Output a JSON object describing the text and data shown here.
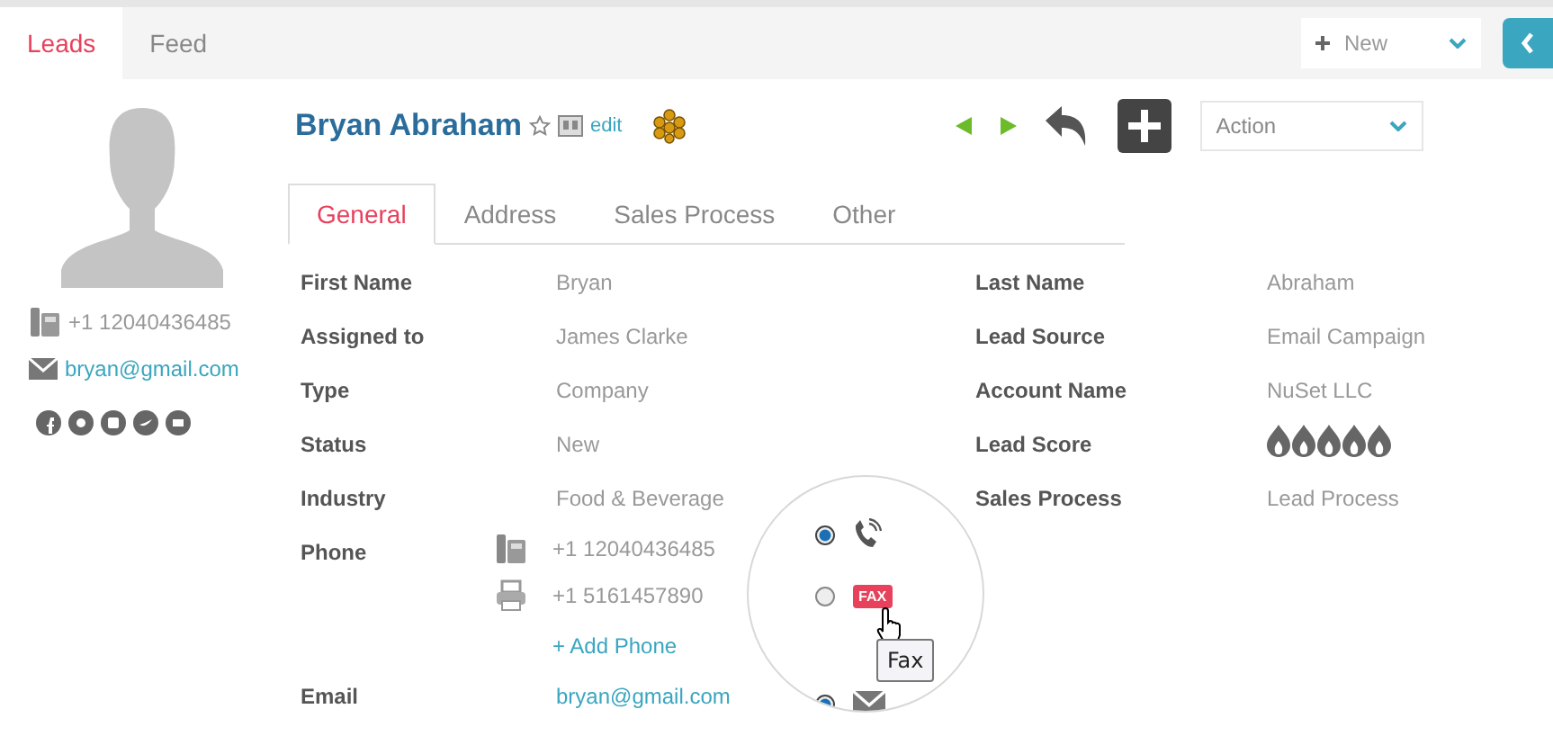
{
  "top_tabs": [
    {
      "label": "Leads",
      "selected": true
    },
    {
      "label": "Feed",
      "selected": false
    }
  ],
  "new_menu": {
    "label": "New"
  },
  "sidebar": {
    "phone": "+1 12040436485",
    "email": "bryan@gmail.com"
  },
  "record": {
    "name": "Bryan Abraham",
    "edit": "edit",
    "action": "Action"
  },
  "tabs": [
    {
      "label": "General",
      "selected": true
    },
    {
      "label": "Address",
      "selected": false
    },
    {
      "label": "Sales Process",
      "selected": false
    },
    {
      "label": "Other",
      "selected": false
    }
  ],
  "fields_left": [
    {
      "kind": "text",
      "label": "First Name",
      "value": "Bryan"
    },
    {
      "kind": "text",
      "label": "Assigned to",
      "value": "James Clarke"
    },
    {
      "kind": "text",
      "label": "Type",
      "value": "Company"
    },
    {
      "kind": "text",
      "label": "Status",
      "value": "New"
    },
    {
      "kind": "text",
      "label": "Industry",
      "value": "Food & Beverage"
    },
    {
      "kind": "phones",
      "label": "Phone",
      "phones": [
        {
          "kind": "phone",
          "value": "+1 12040436485"
        },
        {
          "kind": "fax",
          "value": "+1 5161457890"
        }
      ],
      "add": "+ Add Phone"
    },
    {
      "kind": "link",
      "label": "Email",
      "value": "bryan@gmail.com"
    }
  ],
  "fields_right": [
    {
      "kind": "text",
      "label": "Last Name",
      "value": "Abraham"
    },
    {
      "kind": "text",
      "label": "Lead Source",
      "value": "Email Campaign"
    },
    {
      "kind": "text",
      "label": "Account Name",
      "value": "NuSet LLC"
    },
    {
      "kind": "score",
      "label": "Lead Score",
      "stars": 5
    },
    {
      "kind": "text",
      "label": "Sales Process",
      "value": "Lead Process"
    }
  ],
  "magnifier": {
    "options": [
      {
        "kind": "phone",
        "selected": true
      },
      {
        "kind": "fax",
        "selected": false,
        "badge": "FAX"
      },
      {
        "kind": "email",
        "selected": true
      }
    ],
    "tooltip": "Fax"
  }
}
